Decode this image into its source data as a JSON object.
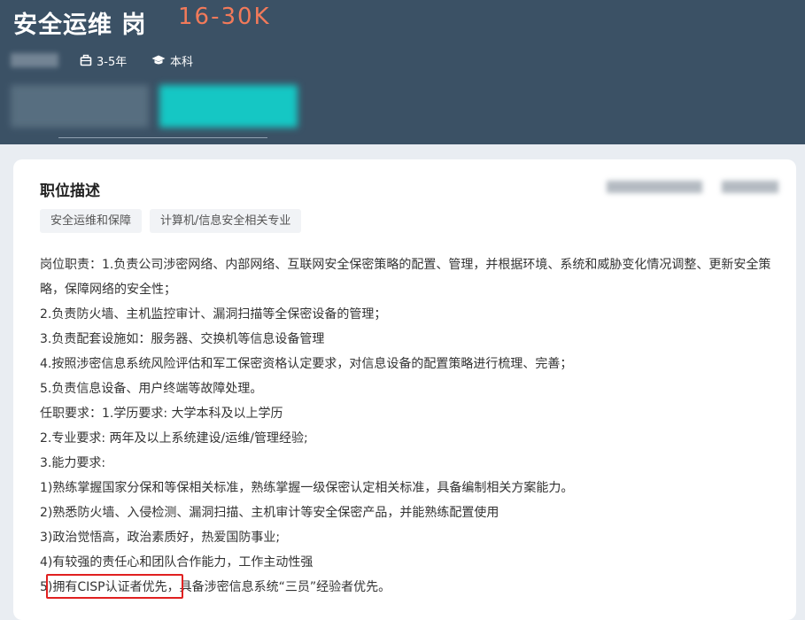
{
  "job": {
    "title": "安全运维 岗",
    "salary": "16-30K",
    "experience": "3-5年",
    "education": "本科",
    "experience_icon": "briefcase-icon",
    "education_icon": "graduation-cap-icon"
  },
  "section": {
    "title": "职位描述",
    "tags": [
      "安全运维和保障",
      "计算机/信息安全相关专业"
    ]
  },
  "description": [
    "岗位职责：1.负责公司涉密网络、内部网络、互联网安全保密策略的配置、管理，并根据环境、系统和威胁变化情况调整、更新安全策略，保障网络的安全性；",
    "2.负责防火墙、主机监控审计、漏洞扫描等全保密设备的管理；",
    "3.负责配套设施如：服务器、交换机等信息设备管理",
    "4.按照涉密信息系统风险评估和军工保密资格认定要求，对信息设备的配置策略进行梳理、完善；",
    "5.负责信息设备、用户终端等故障处理。",
    "任职要求：1.学历要求: 大学本科及以上学历",
    "2.专业要求: 两年及以上系统建设/运维/管理经验;",
    "3.能力要求:",
    "1)熟练掌握国家分保和等保相关标准，熟练掌握一级保密认定相关标准，具备编制相关方案能力。",
    "2)熟悉防火墙、入侵检测、漏洞扫描、主机审计等安全保密产品，并能熟练配置使用",
    "3)政治觉悟高，政治素质好，热爱国防事业;",
    "4)有较强的责任心和团队合作能力，工作主动性强",
    "5)拥有CISP认证者优先，具备涉密信息系统“三员”经验者优先。"
  ],
  "colors": {
    "header_bg": "#3b5165",
    "salary": "#f27a5a",
    "highlight_box": "#e02020",
    "tag_bg": "#f1f3f6"
  }
}
